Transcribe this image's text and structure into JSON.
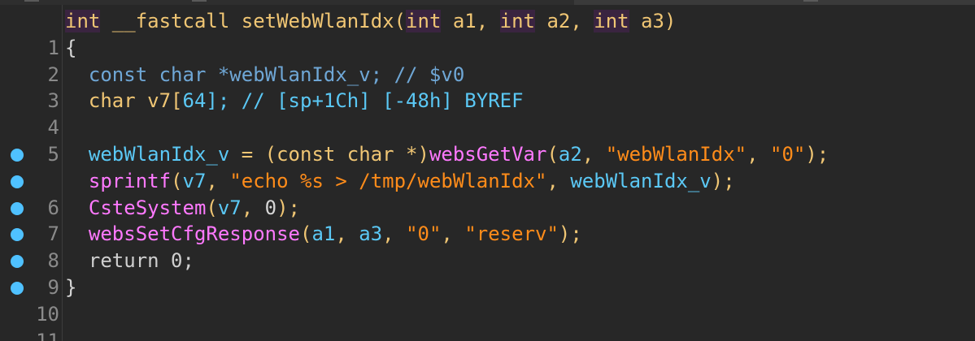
{
  "editor": {
    "lines": [
      {
        "num": "1",
        "bp": false
      },
      {
        "num": "2",
        "bp": false
      },
      {
        "num": "3",
        "bp": false
      },
      {
        "num": "4",
        "bp": false
      },
      {
        "num": "5",
        "bp": false
      },
      {
        "num": "6",
        "bp": true
      },
      {
        "num": "7",
        "bp": true
      },
      {
        "num": "8",
        "bp": true
      },
      {
        "num": "9",
        "bp": true
      },
      {
        "num": "10",
        "bp": true
      },
      {
        "num": "11",
        "bp": true
      }
    ],
    "tokens": {
      "l1": {
        "t0": "int",
        "t1": " __fastcall ",
        "t2": "setWebWlanIdx",
        "t3": "(",
        "t4": "int",
        "t5": " a1, ",
        "t6": "int",
        "t7": " a2, ",
        "t8": "int",
        "t9": " a3)"
      },
      "l2": {
        "t0": "{"
      },
      "l3": {
        "t0": "  const char *webWlanIdx_v; // $v0"
      },
      "l4": {
        "t0": "  char v7[",
        "t1": "64",
        "t2": "]; // [sp+1Ch] [-48h] BYREF"
      },
      "l5": {
        "t0": ""
      },
      "l6": {
        "t0": "  webWlanIdx_v",
        "t1": " = (const char *)",
        "t2": "websGetVar",
        "t3": "(",
        "t4": "a2",
        "t5": ", ",
        "t6": "\"webWlanIdx\"",
        "t7": ", ",
        "t8": "\"0\"",
        "t9": ");"
      },
      "l7": {
        "t0": "  sprintf",
        "t1": "(",
        "t2": "v7",
        "t3": ", ",
        "t4": "\"echo %s > /tmp/webWlanIdx\"",
        "t5": ", ",
        "t6": "webWlanIdx_v",
        "t7": ");"
      },
      "l8": {
        "t0": "  CsteSystem",
        "t1": "(",
        "t2": "v7",
        "t3": ", ",
        "t4": "0",
        "t5": ");"
      },
      "l9": {
        "t0": "  websSetCfgResponse",
        "t1": "(",
        "t2": "a1",
        "t3": ", ",
        "t4": "a3",
        "t5": ", ",
        "t6": "\"0\"",
        "t7": ", ",
        "t8": "\"reserv\"",
        "t9": ");"
      },
      "l10": {
        "t0": "  return ",
        "t1": "0",
        "t2": ";"
      },
      "l11": {
        "t0": "}"
      }
    }
  },
  "colors": {
    "background": "#272727",
    "keyword": "#f0c674",
    "function": "#ff79ff",
    "variable": "#5bc8f5",
    "string": "#ff8c1a",
    "breakpoint": "#4fc1ff",
    "line_number": "#8a8a8a"
  }
}
